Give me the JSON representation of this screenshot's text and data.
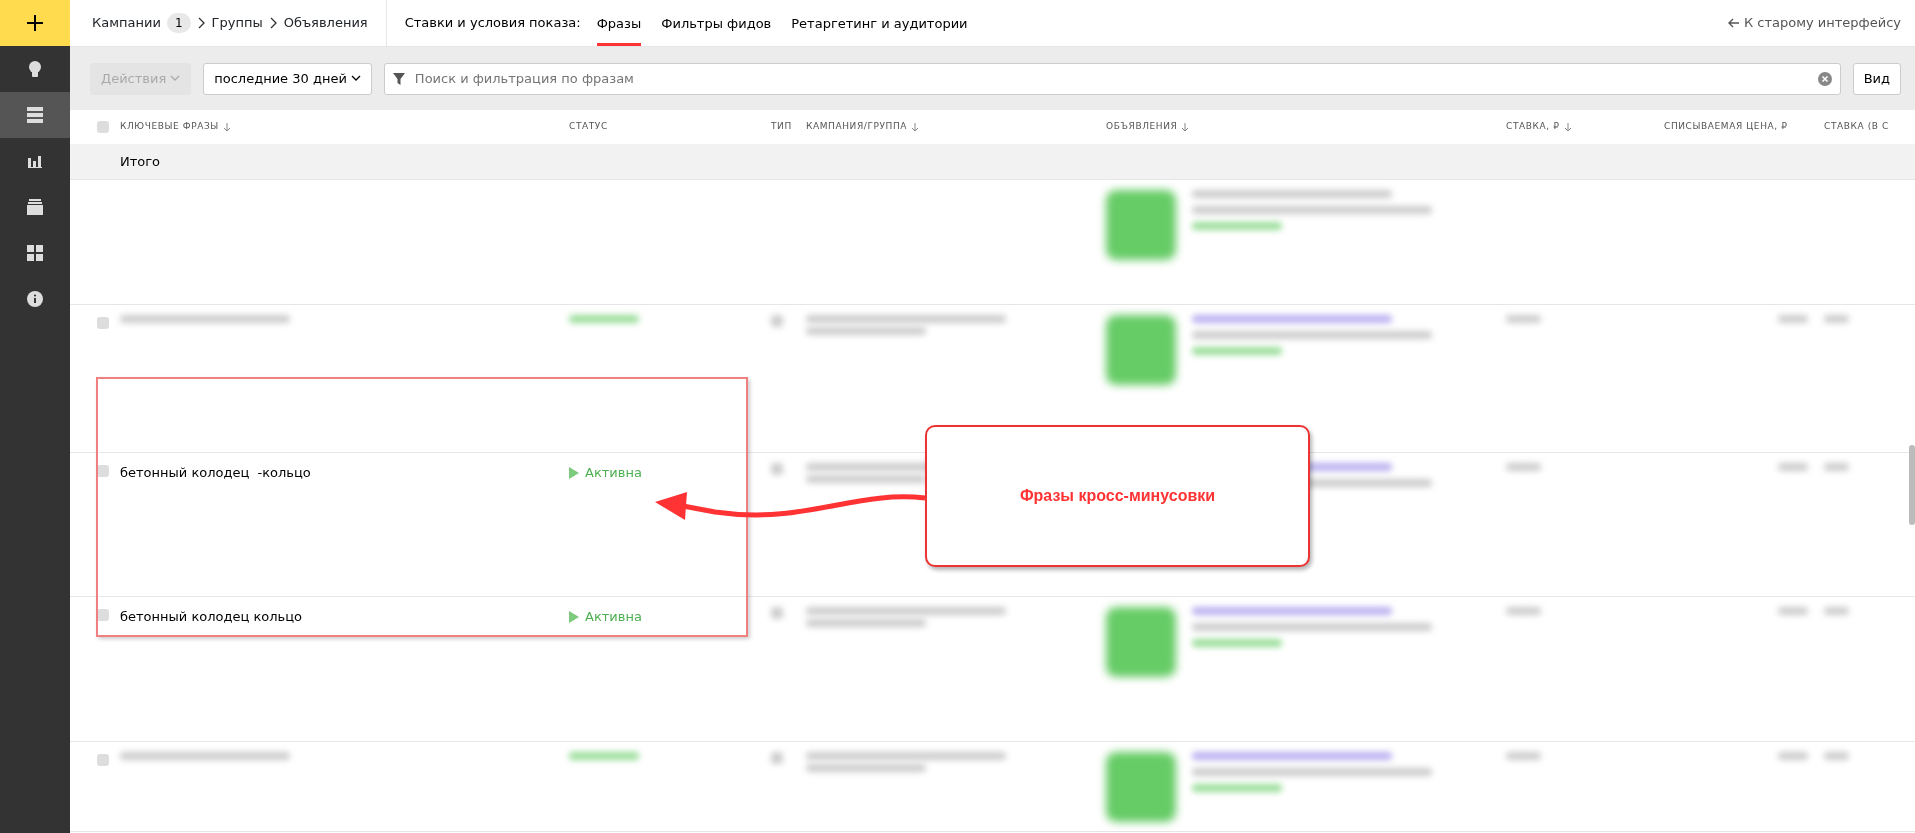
{
  "sidebar": {
    "items": [
      {
        "kind": "plus",
        "selected": false
      },
      {
        "kind": "bulb",
        "selected": false
      },
      {
        "kind": "list",
        "selected": true
      },
      {
        "kind": "chart",
        "selected": false
      },
      {
        "kind": "stack",
        "selected": false
      },
      {
        "kind": "grid",
        "selected": false
      },
      {
        "kind": "info",
        "selected": false
      }
    ]
  },
  "breadcrumbs": [
    {
      "label": "Кампании",
      "count": "1"
    },
    {
      "label": "Группы"
    },
    {
      "label": "Объявления"
    }
  ],
  "tabs_label": "Ставки и условия показа:",
  "tabs": [
    {
      "label": "Фразы",
      "selected": true
    },
    {
      "label": "Фильтры фидов",
      "selected": false
    },
    {
      "label": "Ретаргетинг и аудитории",
      "selected": false
    }
  ],
  "old_interface_link": "К старому интерфейсу",
  "toolbar": {
    "actions": {
      "label": "Действия",
      "disabled": true
    },
    "period": "последние 30 дней",
    "search": {
      "placeholder": "Поиск и фильтрация по фразам"
    },
    "view_button": "Вид"
  },
  "table": {
    "select_all": {
      "checked": false
    },
    "columns": [
      {
        "label": "КЛЮЧЕВЫЕ ФРАЗЫ",
        "sortable": true
      },
      {
        "label": "СТАТУС",
        "sortable": false
      },
      {
        "label": "ТИП",
        "sortable": false
      },
      {
        "label": "КАМПАНИЯ/ГРУППА",
        "sortable": true
      },
      {
        "label": "ОБЪЯВЛЕНИЯ",
        "sortable": true
      },
      {
        "label": "СТАВКА, ₽",
        "sortable": true
      },
      {
        "label": "СПИСЫВАЕМАЯ ЦЕНА, ₽",
        "sortable": false
      },
      {
        "label": "СТАВКА (В С",
        "sortable": false
      }
    ],
    "total_label": "Итого",
    "rows": [
      {
        "kind": "blurred"
      },
      {
        "kind": "blurred",
        "checked": false
      },
      {
        "kind": "phrase",
        "checked": false,
        "phrase": "бетонный колодец  -кольцо",
        "status": "Активна"
      },
      {
        "kind": "phrase",
        "checked": false,
        "phrase": "бетонный колодец кольцо",
        "status": "Активна"
      },
      {
        "kind": "blurred",
        "checked": false
      }
    ]
  },
  "annotation": {
    "callout": "Фразы кросс-минусовки"
  }
}
